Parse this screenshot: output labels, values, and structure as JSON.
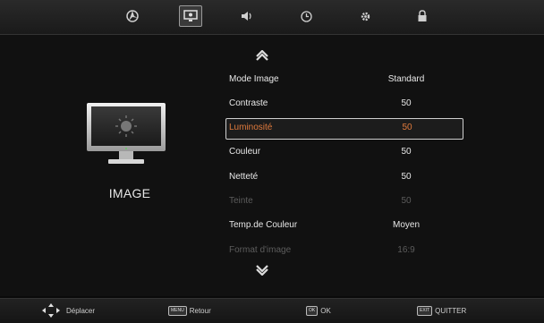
{
  "tabs": [
    {
      "icon": "picture-tab-icon",
      "active": false
    },
    {
      "icon": "monitor-tab-icon",
      "active": true
    },
    {
      "icon": "speaker-tab-icon",
      "active": false
    },
    {
      "icon": "clock-tab-icon",
      "active": false
    },
    {
      "icon": "gear-tab-icon",
      "active": false
    },
    {
      "icon": "lock-tab-icon",
      "active": false
    }
  ],
  "side": {
    "title": "IMAGE",
    "icon": "monitor-sun-icon"
  },
  "menu": {
    "items": [
      {
        "label": "Mode Image",
        "value": "Standard"
      },
      {
        "label": "Contraste",
        "value": "50"
      },
      {
        "label": "Luminosité",
        "value": "50"
      },
      {
        "label": "Couleur",
        "value": "50"
      },
      {
        "label": "Netteté",
        "value": "50"
      },
      {
        "label": "Teinte",
        "value": "50"
      },
      {
        "label": "Temp.de Couleur",
        "value": "Moyen"
      },
      {
        "label": "Format d'image",
        "value": "16:9"
      }
    ],
    "selected_index": 2,
    "disabled_indices": [
      5,
      7
    ]
  },
  "hints": {
    "move": {
      "label": "Déplacer"
    },
    "back": {
      "key": "MENU",
      "label": "Retour"
    },
    "ok": {
      "key": "OK",
      "label": "OK"
    },
    "exit": {
      "key": "EXIT",
      "label": "QUITTER"
    }
  },
  "colors": {
    "accent": "#e07a3c",
    "text": "#e8e8e8",
    "disabled": "#5c5c5c"
  }
}
